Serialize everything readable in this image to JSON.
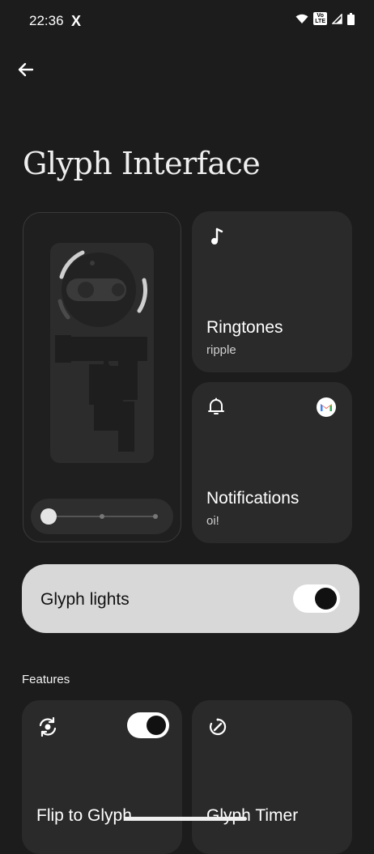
{
  "status_bar": {
    "time": "22:36",
    "x_logo": "X",
    "volte": "Vo LTE"
  },
  "page": {
    "title": "Glyph Interface"
  },
  "tiles": {
    "ringtones": {
      "title": "Ringtones",
      "subtitle": "ripple",
      "icon": "music-note-icon"
    },
    "notifications": {
      "title": "Notifications",
      "subtitle": "oi!",
      "icon": "bell-icon",
      "app_icon": "gmail-icon"
    }
  },
  "glyph_lights": {
    "label": "Glyph lights",
    "enabled": true
  },
  "features": {
    "heading": "Features",
    "items": [
      {
        "label": "Flip to Glyph",
        "icon": "flip-icon",
        "enabled": true
      },
      {
        "label": "Glyph Timer",
        "icon": "timer-icon"
      }
    ]
  },
  "colors": {
    "background": "#1c1c1c",
    "tile": "#2a2a2a",
    "lights_card": "#d8d8d8"
  }
}
